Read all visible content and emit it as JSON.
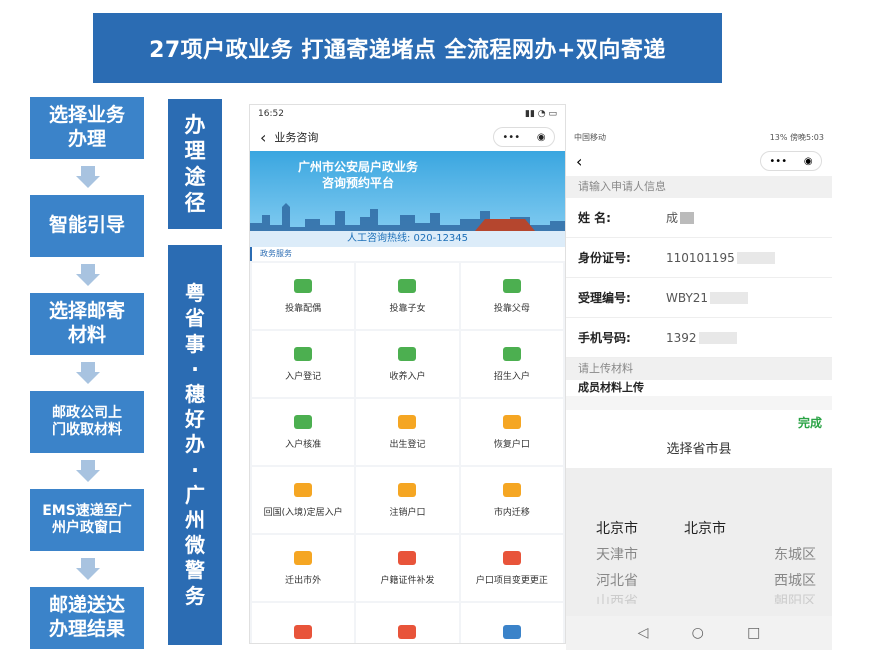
{
  "banner": {
    "title": "27项户政业务 打通寄递堵点 全流程网办+双向寄递"
  },
  "steps": [
    {
      "label": "选择业务\n办理"
    },
    {
      "label": "智能引导"
    },
    {
      "label": "选择邮寄\n材料"
    },
    {
      "label": "邮政公司上\n门收取材料"
    },
    {
      "label": "EMS速递至广\n州户政窗口"
    },
    {
      "label": "邮递送达\n办理结果"
    }
  ],
  "side_labels": {
    "path": "办\n理\n途\n径",
    "platforms": "粤\n省\n事\n·\n穗\n好\n办\n·\n广\n州\n微\n警\n务"
  },
  "phone1": {
    "status_time": "16:52",
    "nav_title": "业务咨询",
    "hero_title": "广州市公安局户政业务\n咨询预约平台",
    "hotline": "人工咨询热线: 020-12345",
    "section": "政务服务",
    "items": [
      {
        "label": "投靠配偶",
        "icon": "couple-icon",
        "color": "green"
      },
      {
        "label": "投靠子女",
        "icon": "child-icon",
        "color": "green"
      },
      {
        "label": "投靠父母",
        "icon": "parent-icon",
        "color": "green"
      },
      {
        "label": "入户登记",
        "icon": "id-card-icon",
        "color": "green"
      },
      {
        "label": "收养入户",
        "icon": "adopt-icon",
        "color": "green"
      },
      {
        "label": "招生入户",
        "icon": "graduate-icon",
        "color": "green"
      },
      {
        "label": "入户核准",
        "icon": "check-icon",
        "color": "green"
      },
      {
        "label": "出生登记",
        "icon": "baby-icon",
        "color": "yellow"
      },
      {
        "label": "恢复户口",
        "icon": "restore-icon",
        "color": "yellow"
      },
      {
        "label": "回国(入境)定居入户",
        "icon": "return-icon",
        "color": "yellow"
      },
      {
        "label": "注销户口",
        "icon": "cancel-icon",
        "color": "yellow"
      },
      {
        "label": "市内迁移",
        "icon": "move-icon",
        "color": "yellow"
      },
      {
        "label": "迁出市外",
        "icon": "out-icon",
        "color": "yellow"
      },
      {
        "label": "户籍证件补发",
        "icon": "reissue-icon",
        "color": "red"
      },
      {
        "label": "户口项目变更更正",
        "icon": "edit-icon",
        "color": "red"
      },
      {
        "label": "",
        "icon": "house-icon",
        "color": "red"
      },
      {
        "label": "",
        "icon": "doc-icon",
        "color": "red"
      },
      {
        "label": "",
        "icon": "card-icon",
        "color": "blue"
      }
    ]
  },
  "phone2": {
    "status_left": "中国移动",
    "status_right": "13% 傍晚5:03",
    "section1": "请输入申请人信息",
    "fields": [
      {
        "label": "姓 名:",
        "value": "成"
      },
      {
        "label": "身份证号:",
        "value": "110101195"
      },
      {
        "label": "受理编号:",
        "value": "WBY21"
      },
      {
        "label": "手机号码:",
        "value": "1392"
      }
    ],
    "section2": "请上传材料",
    "clip_text": "成员材料上传",
    "picker": {
      "done": "完成",
      "title": "选择省市县",
      "col1": [
        "北京市",
        "天津市",
        "河北省",
        "山西省"
      ],
      "col2": [
        "北京市"
      ],
      "col3": [
        "东城区",
        "西城区",
        "朝阳区"
      ]
    },
    "android": {
      "back": "◁",
      "home": "○",
      "recent": "□"
    }
  }
}
